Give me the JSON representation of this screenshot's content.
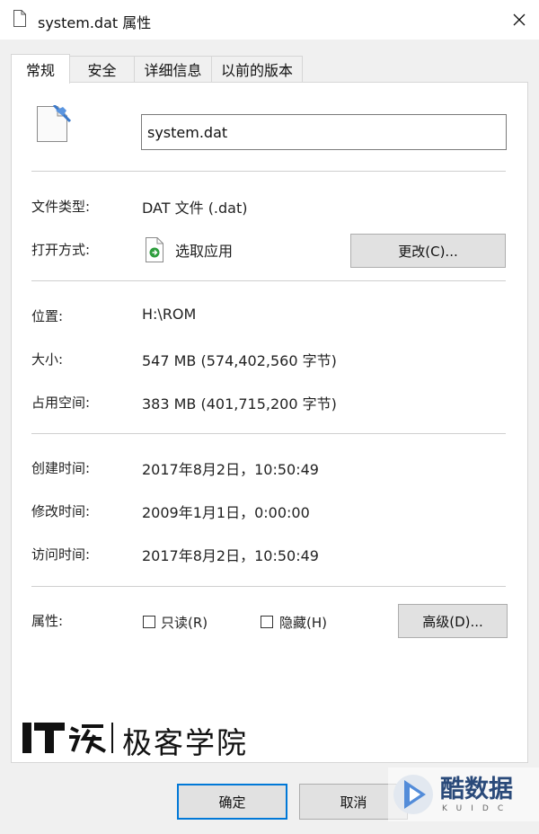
{
  "window": {
    "title": "system.dat 属性"
  },
  "tabs": [
    {
      "label": "常规",
      "active": true
    },
    {
      "label": "安全",
      "active": false
    },
    {
      "label": "详细信息",
      "active": false
    },
    {
      "label": "以前的版本",
      "active": false
    }
  ],
  "general": {
    "file_name": "system.dat",
    "file_type_label": "文件类型:",
    "file_type_value": "DAT 文件 (.dat)",
    "open_with_label": "打开方式:",
    "open_with_value": "选取应用",
    "change_button": "更改(C)...",
    "location_label": "位置:",
    "location_value": "H:\\ROM",
    "size_label": "大小:",
    "size_value": "547 MB (574,402,560 字节)",
    "size_on_disk_label": "占用空间:",
    "size_on_disk_value": "383 MB (401,715,200 字节)",
    "created_label": "创建时间:",
    "created_value": "2017年8月2日，10:50:49",
    "modified_label": "修改时间:",
    "modified_value": "2009年1月1日，0:00:00",
    "accessed_label": "访问时间:",
    "accessed_value": "2017年8月2日，10:50:49",
    "attributes_label": "属性:",
    "readonly_label": "只读(R)",
    "readonly_checked": false,
    "hidden_label": "隐藏(H)",
    "hidden_checked": false,
    "advanced_button": "高级(D)..."
  },
  "footer": {
    "ok_button": "确定",
    "cancel_button": "取消"
  },
  "watermarks": {
    "ithome_text": "极客学院",
    "kuido_text": "酷数据",
    "kuido_sub": "KUIDC"
  },
  "colors": {
    "accent": "#0078d7",
    "window_bg": "#f0f0f0",
    "panel_bg": "#ffffff"
  }
}
